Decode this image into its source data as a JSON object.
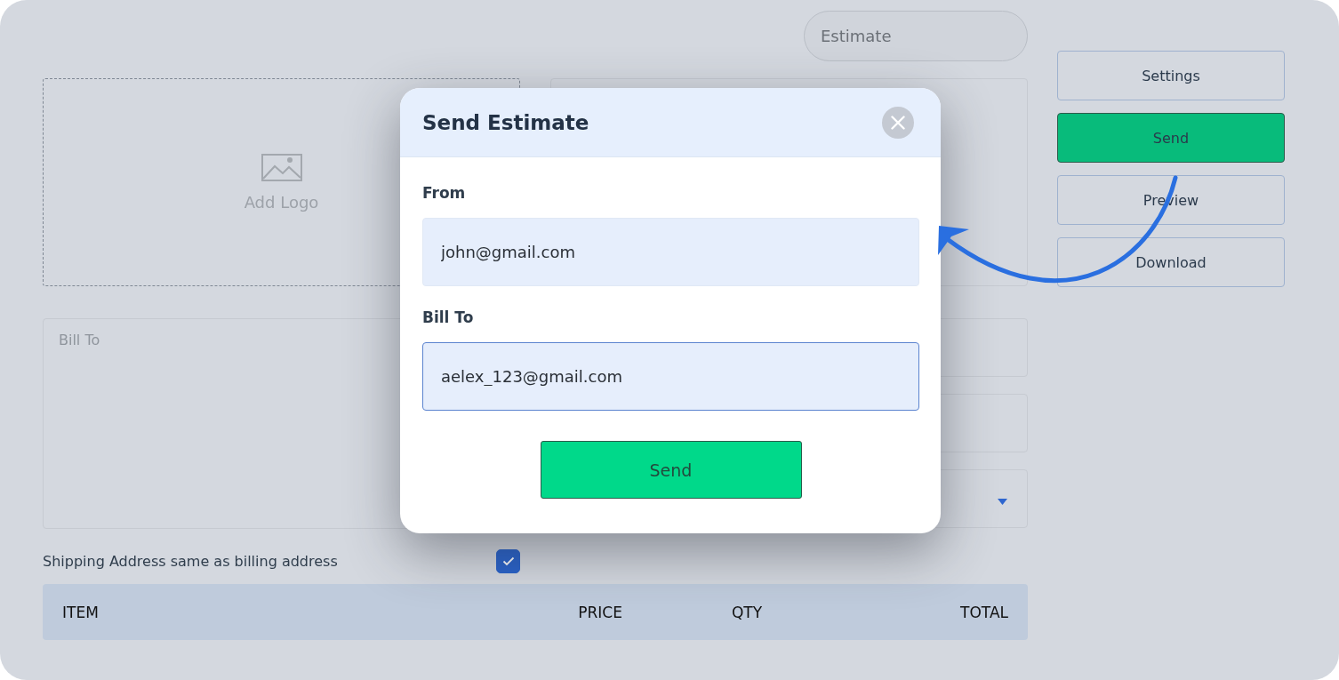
{
  "estimate_field": {
    "placeholder": "Estimate"
  },
  "logo_upload": {
    "label": "Add Logo"
  },
  "bill_to": {
    "placeholder": "Bill To"
  },
  "shipping_same": {
    "label": "Shipping Address same as billing address",
    "checked": true
  },
  "table": {
    "columns": [
      "ITEM",
      "PRICE",
      "QTY",
      "TOTAL"
    ]
  },
  "actions": [
    {
      "label": "Settings",
      "selected": false
    },
    {
      "label": "Send",
      "selected": true
    },
    {
      "label": "Preview",
      "selected": false
    },
    {
      "label": "Download",
      "selected": false
    }
  ],
  "modal": {
    "title": "Send Estimate",
    "fields": [
      {
        "label": "From",
        "value": "john@gmail.com",
        "focused": false
      },
      {
        "label": "Bill To",
        "value": "aelex_123@gmail.com",
        "focused": true
      }
    ],
    "submit": "Send"
  }
}
